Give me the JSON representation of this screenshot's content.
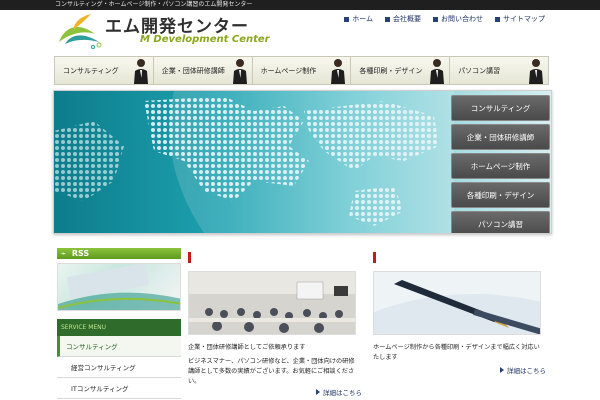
{
  "topbar": {
    "text": "コンサルティング・ホームページ制作・パソコン講習のエム開発センター"
  },
  "logo": {
    "title": "エム開発センター",
    "subtitle": "M Development Center"
  },
  "toplinks": [
    "ホーム",
    "会社概要",
    "お問い合わせ",
    "サイトマップ"
  ],
  "nav": [
    "コンサルティング",
    "企業・団体研修講師",
    "ホームページ制作",
    "各種印刷・デザイン",
    "パソコン講習"
  ],
  "hero_buttons": [
    "コンサルティング",
    "企業・団体研修講師",
    "ホームページ制作",
    "各種印刷・デザイン",
    "パソコン講習"
  ],
  "sidebar": {
    "rss": "RSS",
    "service_title": "SERVICE MENU",
    "items": [
      "コンサルティング",
      "経営コンサルティング",
      "ITコンサルティング"
    ]
  },
  "columns": [
    {
      "title": "企業・団体研修講師としてご依頼承ります",
      "body": "ビジネスマナー、パソコン研修など、企業・団体向けの研修講師として多数の実績がございます。お気軽にご相談ください。",
      "detail": "詳細はこちら"
    },
    {
      "title": "ホームページ制作から各種印刷・デザインまで幅広く対応いたします",
      "body": "",
      "detail": "詳細はこちら"
    }
  ],
  "colors": {
    "accent_green": "#5d9a1f",
    "nav_dark": "#4a4a4a",
    "link_blue": "#1a2f66",
    "marker_red": "#c81919"
  }
}
